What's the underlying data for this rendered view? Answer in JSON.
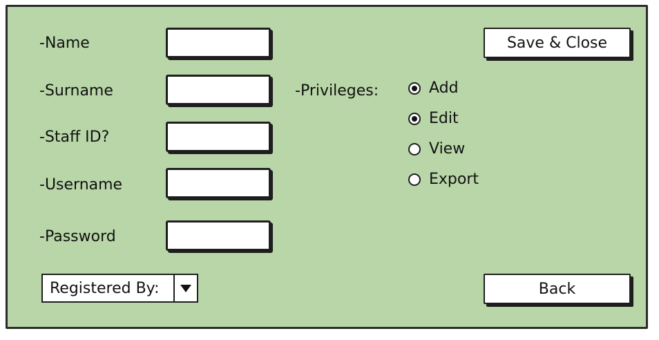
{
  "form": {
    "name_label": "-Name",
    "surname_label": "-Surname",
    "staff_id_label": "-Staff ID?",
    "username_label": "-Username",
    "password_label": "-Password",
    "name_value": "",
    "surname_value": "",
    "staff_id_value": "",
    "username_value": "",
    "password_value": ""
  },
  "privileges": {
    "label": "-Privileges:",
    "options": [
      {
        "label": "Add",
        "checked": true
      },
      {
        "label": "Edit",
        "checked": true
      },
      {
        "label": "View",
        "checked": false
      },
      {
        "label": "Export",
        "checked": false
      }
    ]
  },
  "registered_by": {
    "value": "Registered By:"
  },
  "buttons": {
    "save_close": "Save & Close",
    "back": "Back"
  }
}
